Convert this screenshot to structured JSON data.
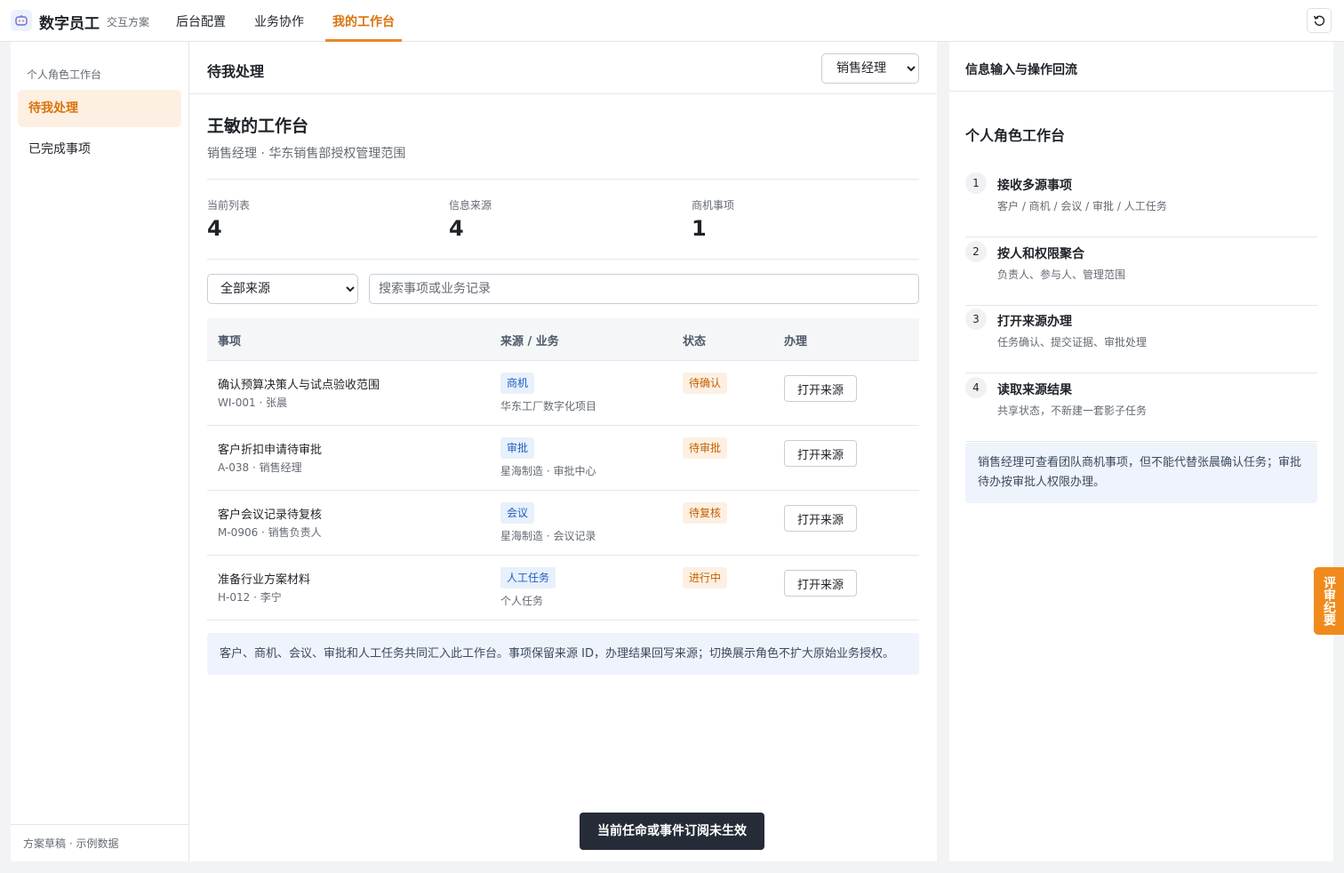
{
  "app": {
    "brand": "数字员工",
    "subtitle": "交互方案",
    "tabs": [
      {
        "label": "后台配置"
      },
      {
        "label": "业务协作"
      },
      {
        "label": "我的工作台"
      }
    ],
    "active_tab": "我的工作台",
    "colors": {
      "accent": "#e8892a",
      "accent_text": "#d9730d",
      "tag_blue": "#1d5fc2",
      "tag_orange": "#c45e00"
    }
  },
  "sidebar": {
    "group_label": "个人角色工作台",
    "items": [
      {
        "label": "待我处理",
        "active": true
      },
      {
        "label": "已完成事项",
        "active": false
      }
    ],
    "footer": "方案草稿 · 示例数据"
  },
  "main": {
    "title": "待我处理",
    "role_select": {
      "selected": "销售经理"
    },
    "workspace_title": "王敏的工作台",
    "workspace_sub": "销售经理 · 华东销售部授权管理范围",
    "stats": [
      {
        "label": "当前列表",
        "value": "4"
      },
      {
        "label": "信息来源",
        "value": "4"
      },
      {
        "label": "商机事项",
        "value": "1"
      }
    ],
    "source_filter": {
      "selected": "全部来源"
    },
    "search": {
      "placeholder": "搜索事项或业务记录",
      "value": ""
    },
    "table": {
      "headers": [
        "事项",
        "来源 / 业务",
        "状态",
        "办理"
      ],
      "rows": [
        {
          "title": "确认预算决策人与试点验收范围",
          "meta": "WI-001 · 张晨",
          "biz_tag": "商机",
          "biz_sub": "华东工厂数字化项目",
          "status": "待确认",
          "action": "打开来源"
        },
        {
          "title": "客户折扣申请待审批",
          "meta": "A-038 · 销售经理",
          "biz_tag": "审批",
          "biz_sub": "星海制造 · 审批中心",
          "status": "待审批",
          "action": "打开来源"
        },
        {
          "title": "客户会议记录待复核",
          "meta": "M-0906 · 销售负责人",
          "biz_tag": "会议",
          "biz_sub": "星海制造 · 会议记录",
          "status": "待复核",
          "action": "打开来源"
        },
        {
          "title": "准备行业方案材料",
          "meta": "H-012 · 李宁",
          "biz_tag": "人工任务",
          "biz_sub": "个人任务",
          "status": "进行中",
          "action": "打开来源"
        }
      ]
    },
    "note": "客户、商机、会议、审批和人工任务共同汇入此工作台。事项保留来源 ID，办理结果回写来源；切换展示角色不扩大原始业务授权。",
    "toast": "当前任命或事件订阅未生效"
  },
  "right_panel": {
    "title": "信息输入与操作回流",
    "subtitle": "个人角色工作台",
    "steps": [
      {
        "num": "1",
        "title": "接收多源事项",
        "desc": "客户 / 商机 / 会议 / 审批 / 人工任务"
      },
      {
        "num": "2",
        "title": "按人和权限聚合",
        "desc": "负责人、参与人、管理范围"
      },
      {
        "num": "3",
        "title": "打开来源办理",
        "desc": "任务确认、提交证据、审批处理"
      },
      {
        "num": "4",
        "title": "读取来源结果",
        "desc": "共享状态，不新建一套影子任务"
      }
    ],
    "note": "销售经理可查看团队商机事项，但不能代替张晨确认任务；审批待办按审批人权限办理。"
  },
  "review_tab": "评审纪要",
  "icons": {
    "logo": "robot-icon",
    "reset": "reset-icon"
  }
}
